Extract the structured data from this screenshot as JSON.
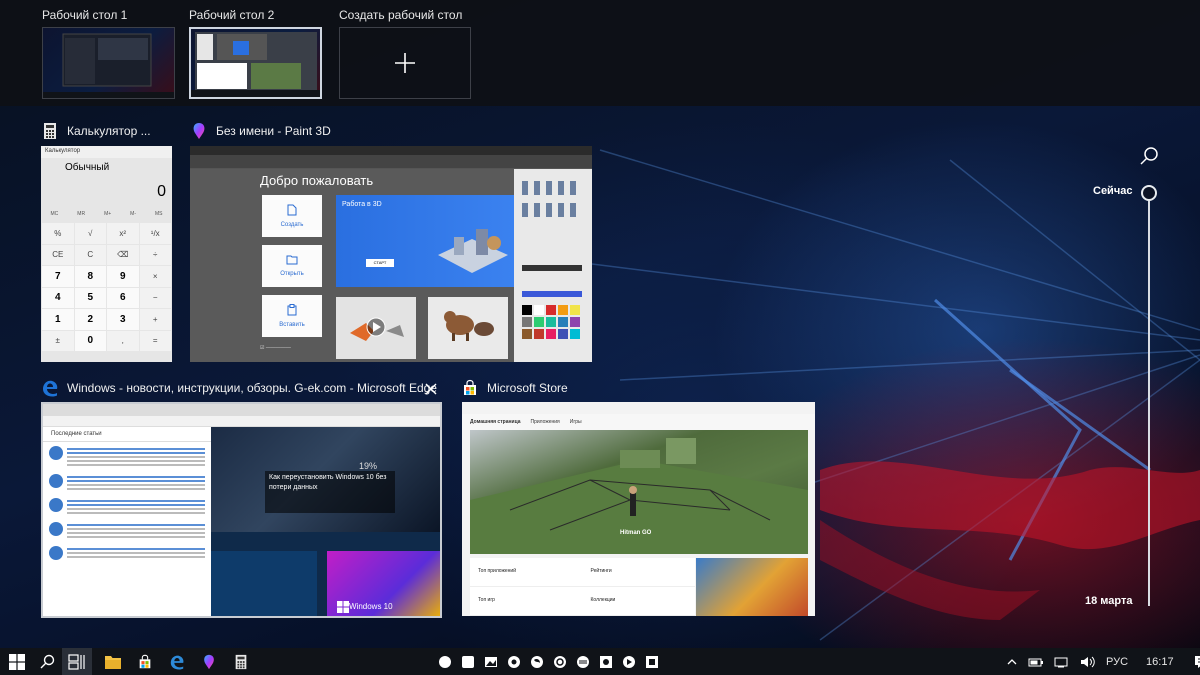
{
  "desktops": [
    {
      "label": "Рабочий стол 1",
      "active": false
    },
    {
      "label": "Рабочий стол 2",
      "active": true
    }
  ],
  "new_desktop_label": "Создать рабочий стол",
  "windows": {
    "calculator": {
      "title": "Калькулятор ...",
      "caption": "Калькулятор",
      "mode": "Обычный",
      "display": "0",
      "memory_keys": [
        "MC",
        "MR",
        "M+",
        "M-",
        "MS"
      ],
      "keys": [
        "%",
        "√",
        "x²",
        "¹/x",
        "CE",
        "C",
        "⌫",
        "÷",
        "7",
        "8",
        "9",
        "×",
        "4",
        "5",
        "6",
        "−",
        "1",
        "2",
        "3",
        "+",
        "±",
        "0",
        ",",
        "="
      ]
    },
    "paint3d": {
      "title": "Без имени - Paint 3D",
      "welcome": "Добро пожаловать",
      "tiles": [
        "Создать",
        "Открыть",
        "Вставить"
      ],
      "promo_title": "Работа в 3D",
      "promo_button": "СТАРТ"
    },
    "edge": {
      "title": "Windows - новости, инструкции, обзоры. G-ek.com - Microsoft Edge",
      "section_header": "Последние статьи",
      "hero_caption": "Как переустановить Windows 10 без потери данных",
      "hero_percent": "19%",
      "tile_label": "Windows 10"
    },
    "store": {
      "title": "Microsoft Store",
      "nav": [
        "Домашняя страница",
        "Приложения",
        "Игры"
      ],
      "featured_game": "Hitman GO",
      "rows": [
        [
          "Топ приложений",
          "Рейтинги"
        ],
        [
          "Топ игр",
          "Коллекции"
        ]
      ]
    }
  },
  "timeline": {
    "now_label": "Сейчас",
    "date_label": "18 марта"
  },
  "taskbar": {
    "language": "РУС",
    "time": "16:17"
  },
  "colors": {
    "strip_bg": "#0e1016",
    "taskbar_bg": "#101318",
    "edge_blue": "#1e73d7",
    "store_blue": "#2d8ad8"
  }
}
